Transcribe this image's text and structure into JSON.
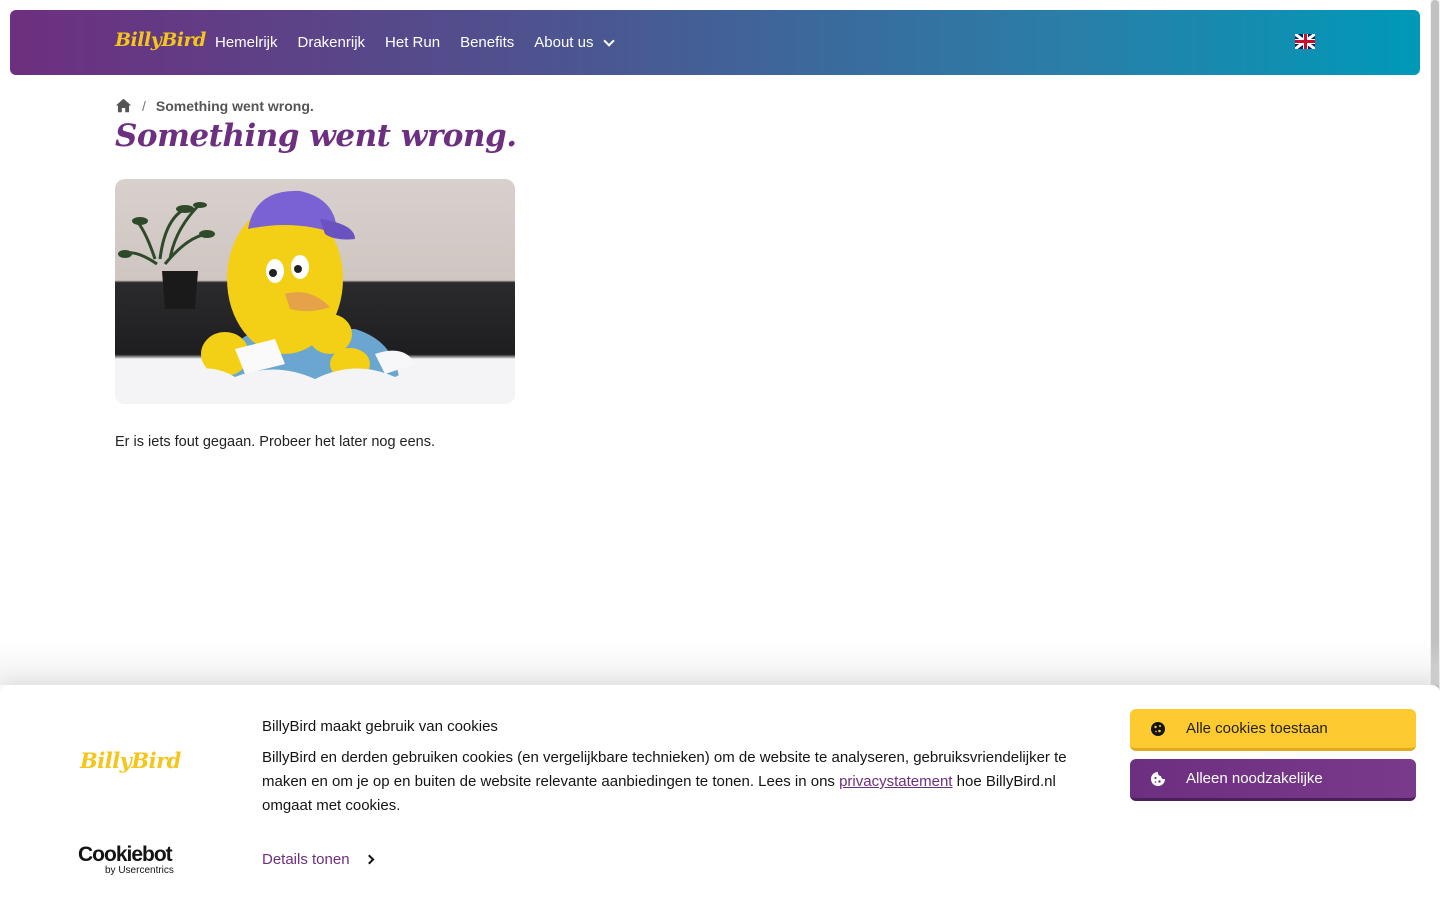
{
  "colors": {
    "brand_purple": "#6d2f7f",
    "brand_teal": "#0099b8",
    "brand_yellow": "#f5c51a",
    "button_yellow": "#fdca2f"
  },
  "header": {
    "logo_text": "BillyBird",
    "nav": [
      {
        "label": "Hemelrijk"
      },
      {
        "label": "Drakenrijk"
      },
      {
        "label": "Het Run"
      },
      {
        "label": "Benefits"
      },
      {
        "label": "About us",
        "icon": "chevron-down-icon"
      }
    ],
    "language_icon": "uk-flag-icon"
  },
  "breadcrumb": {
    "home_icon": "home-icon",
    "separator": "/",
    "current": "Something went wrong."
  },
  "main": {
    "title": "Something went wrong.",
    "message": "Er is iets fout gegaan. Probeer het later nog eens."
  },
  "cookie_banner": {
    "logo_text": "BillyBird",
    "title": "BillyBird maakt gebruik van cookies",
    "text_before_link": "BillyBird en derden gebruiken cookies (en vergelijkbare technieken) om de website te analyseren, gebruiksvriendelijker te maken en om je op en buiten de website relevante aanbiedingen te tonen. Lees in ons ",
    "link_text": "privacystatement",
    "text_after_link": " hoe BillyBird.nl omgaat met cookies.",
    "details_label": "Details tonen",
    "allow_all_label": "Alle cookies toestaan",
    "necessary_only_label": "Alleen noodzakelijke",
    "cookiebot_name": "Cookiebot",
    "cookiebot_sub": "by Usercentrics"
  }
}
